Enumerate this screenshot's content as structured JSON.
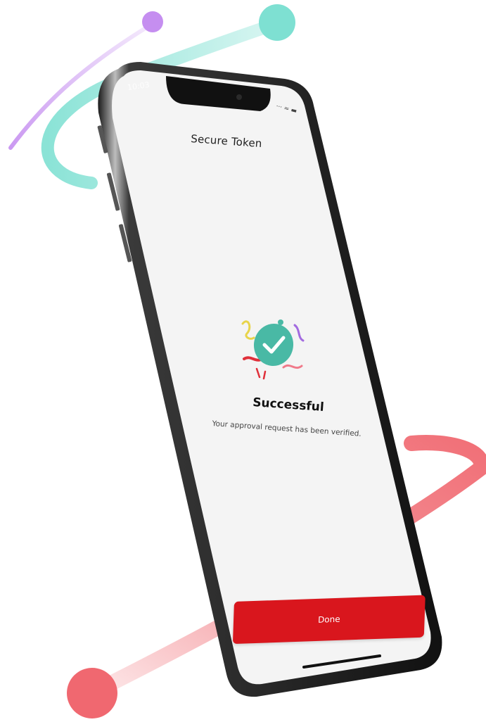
{
  "app": {
    "screen_title": "Secure Token",
    "status_time": "10:03",
    "status_icons": "··· ≈ ▬"
  },
  "result": {
    "heading": "Successful",
    "message": "Your approval request has been verified."
  },
  "actions": {
    "done_label": "Done"
  },
  "colors": {
    "accent": "#d9161d",
    "success": "#49b9a5",
    "deco_teal": "#7ee0d2",
    "deco_purple": "#c58ef0",
    "deco_red": "#f06870"
  },
  "icons": {
    "success": "checkmark-circle-icon"
  }
}
